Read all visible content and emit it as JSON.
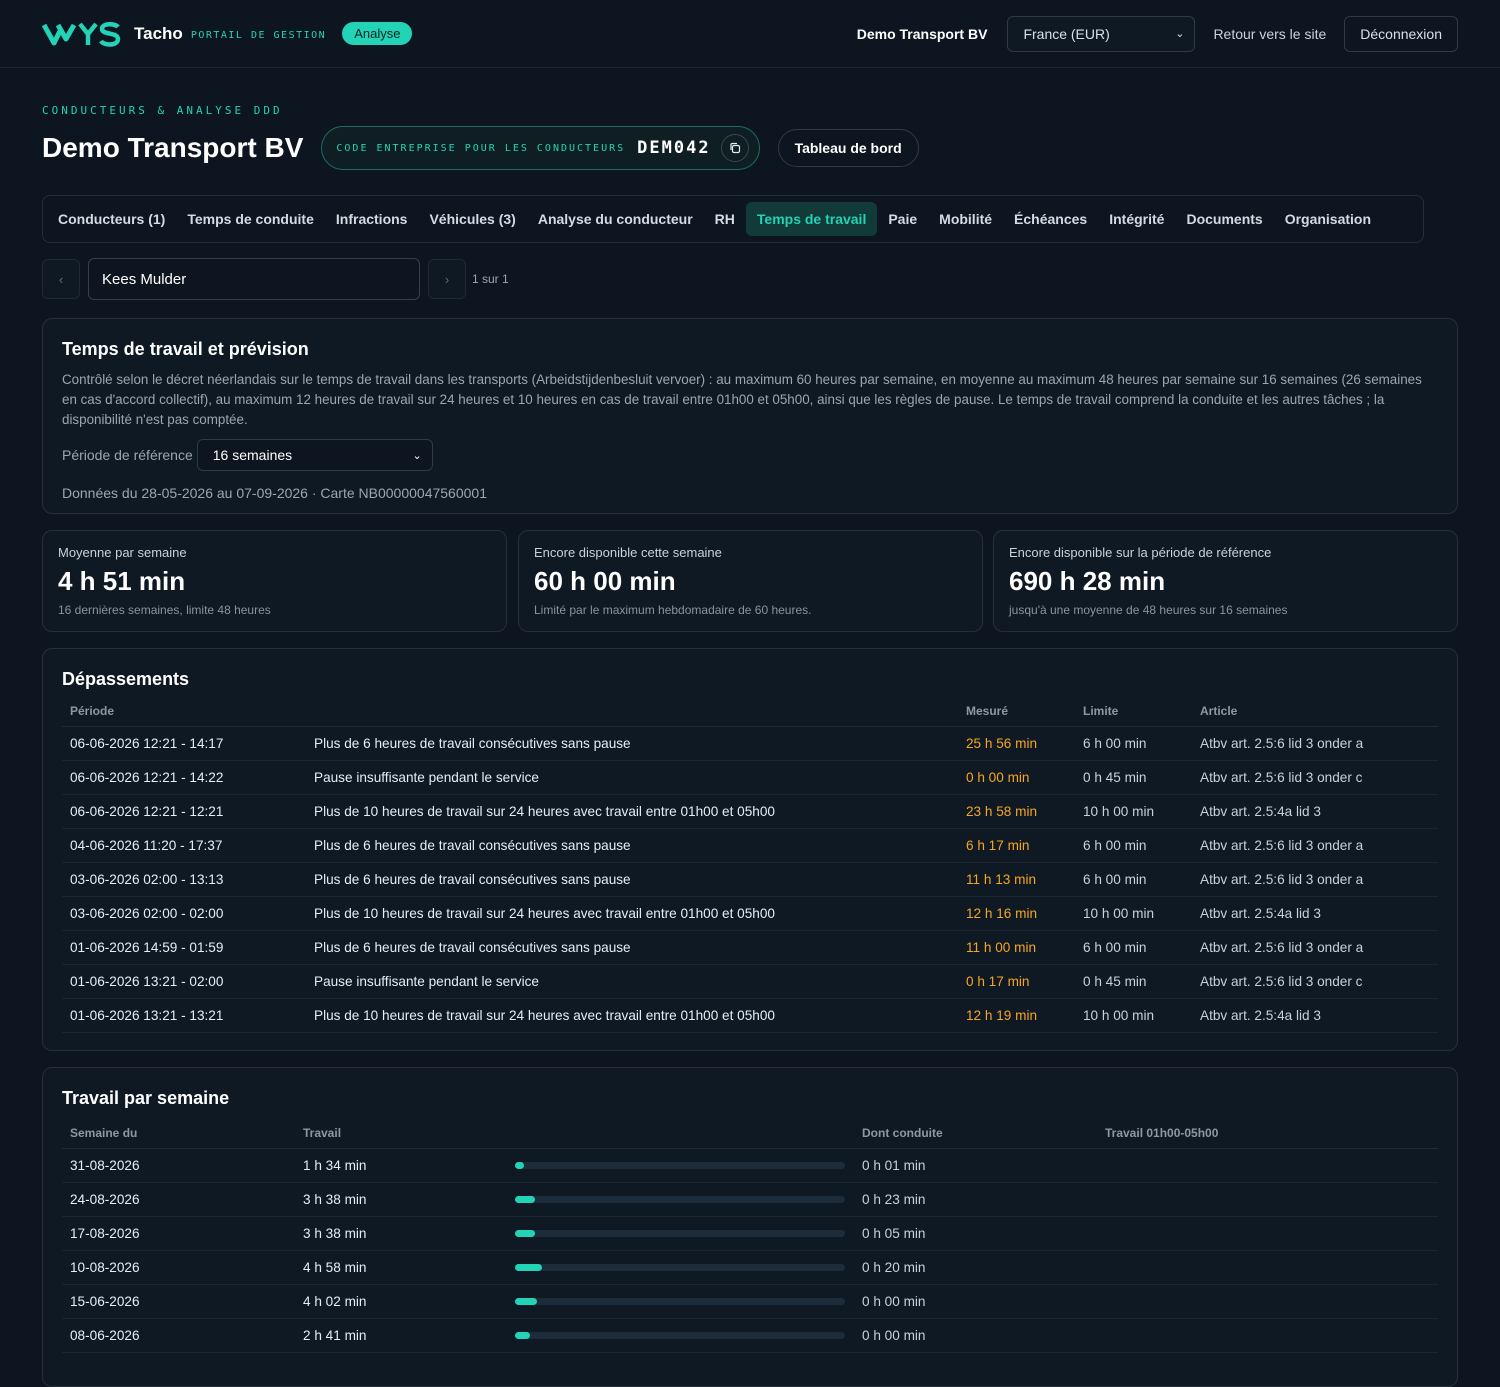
{
  "header": {
    "brand": "Tacho",
    "brand_sub": "PORTAIL DE GESTION",
    "badge": "Analyse",
    "company": "Demo Transport BV",
    "country_select": "France (EUR)",
    "back_link": "Retour vers le site",
    "logout": "Déconnexion",
    "accent_color": "#22d3b6"
  },
  "page": {
    "kicker": "CONDUCTEURS & ANALYSE DDD",
    "title": "Demo Transport BV",
    "code_label": "CODE ENTREPRISE POUR LES CONDUCTEURS",
    "code_value": "DEM042",
    "dashboard_button": "Tableau de bord"
  },
  "tabs": [
    {
      "label": "Conducteurs (1)"
    },
    {
      "label": "Temps de conduite"
    },
    {
      "label": "Infractions"
    },
    {
      "label": "Véhicules (3)"
    },
    {
      "label": "Analyse du conducteur"
    },
    {
      "label": "RH"
    },
    {
      "label": "Temps de travail",
      "active": true
    },
    {
      "label": "Paie"
    },
    {
      "label": "Mobilité"
    },
    {
      "label": "Échéances"
    },
    {
      "label": "Intégrité"
    },
    {
      "label": "Documents"
    },
    {
      "label": "Organisation"
    }
  ],
  "driver": {
    "prev": "‹",
    "next": "›",
    "name": "Kees Mulder",
    "pager": "1 sur 1"
  },
  "intro": {
    "title": "Temps de travail et prévision",
    "description": "Contrôlé selon le décret néerlandais sur le temps de travail dans les transports (Arbeidstijdenbesluit vervoer) : au maximum 60 heures par semaine, en moyenne au maximum 48 heures par semaine sur 16 semaines (26 semaines en cas d'accord collectif), au maximum 12 heures de travail sur 24 heures et 10 heures en cas de travail entre 01h00 et 05h00, ainsi que les règles de pause. Le temps de travail comprend la conduite et les autres tâches ; la disponibilité n'est pas comptée.",
    "ref_label": "Période de référence",
    "ref_value": "16 semaines",
    "data_line": "Données du 28-05-2026 au 07-09-2026 · Carte NB00000047560001"
  },
  "stats": [
    {
      "label": "Moyenne par semaine",
      "value": "4 h 51 min",
      "sub": "16 dernières semaines, limite 48 heures"
    },
    {
      "label": "Encore disponible cette semaine",
      "value": "60 h 00 min",
      "sub": "Limité par le maximum hebdomadaire de 60 heures."
    },
    {
      "label": "Encore disponible sur la période de référence",
      "value": "690 h 28 min",
      "sub": "jusqu'à une moyenne de 48 heures sur 16 semaines"
    }
  ],
  "exceed": {
    "title": "Dépassements",
    "headers": [
      "Période",
      "",
      "Mesuré",
      "Limite",
      "Article"
    ],
    "rows": [
      [
        "06-06-2026 12:21 - 14:17",
        "Plus de 6 heures de travail consécutives sans pause",
        "25 h 56 min",
        "6 h 00 min",
        "Atbv art. 2.5:6 lid 3 onder a"
      ],
      [
        "06-06-2026 12:21 - 14:22",
        "Pause insuffisante pendant le service",
        "0 h 00 min",
        "0 h 45 min",
        "Atbv art. 2.5:6 lid 3 onder c"
      ],
      [
        "06-06-2026 12:21 - 12:21",
        "Plus de 10 heures de travail sur 24 heures avec travail entre 01h00 et 05h00",
        "23 h 58 min",
        "10 h 00 min",
        "Atbv art. 2.5:4a lid 3"
      ],
      [
        "04-06-2026 11:20 - 17:37",
        "Plus de 6 heures de travail consécutives sans pause",
        "6 h 17 min",
        "6 h 00 min",
        "Atbv art. 2.5:6 lid 3 onder a"
      ],
      [
        "03-06-2026 02:00 - 13:13",
        "Plus de 6 heures de travail consécutives sans pause",
        "11 h 13 min",
        "6 h 00 min",
        "Atbv art. 2.5:6 lid 3 onder a"
      ],
      [
        "03-06-2026 02:00 - 02:00",
        "Plus de 10 heures de travail sur 24 heures avec travail entre 01h00 et 05h00",
        "12 h 16 min",
        "10 h 00 min",
        "Atbv art. 2.5:4a lid 3"
      ],
      [
        "01-06-2026 14:59 - 01:59",
        "Plus de 6 heures de travail consécutives sans pause",
        "11 h 00 min",
        "6 h 00 min",
        "Atbv art. 2.5:6 lid 3 onder a"
      ],
      [
        "01-06-2026 13:21 - 02:00",
        "Pause insuffisante pendant le service",
        "0 h 17 min",
        "0 h 45 min",
        "Atbv art. 2.5:6 lid 3 onder c"
      ],
      [
        "01-06-2026 13:21 - 13:21",
        "Plus de 10 heures de travail sur 24 heures avec travail entre 01h00 et 05h00",
        "12 h 19 min",
        "10 h 00 min",
        "Atbv art. 2.5:4a lid 3"
      ]
    ]
  },
  "weekly": {
    "title": "Travail par semaine",
    "headers": [
      "Semaine du",
      "Travail",
      "",
      "Dont conduite",
      "Travail 01h00-05h00"
    ],
    "rows": [
      {
        "week": "31-08-2026",
        "work": "1 h 34 min",
        "fill_percent": 2.6,
        "driving": "0 h 01 min",
        "night": ""
      },
      {
        "week": "24-08-2026",
        "work": "3 h 38 min",
        "fill_percent": 6.1,
        "driving": "0 h 23 min",
        "night": ""
      },
      {
        "week": "17-08-2026",
        "work": "3 h 38 min",
        "fill_percent": 6.1,
        "driving": "0 h 05 min",
        "night": ""
      },
      {
        "week": "10-08-2026",
        "work": "4 h 58 min",
        "fill_percent": 8.3,
        "driving": "0 h 20 min",
        "night": ""
      },
      {
        "week": "15-06-2026",
        "work": "4 h 02 min",
        "fill_percent": 6.7,
        "driving": "0 h 00 min",
        "night": ""
      },
      {
        "week": "08-06-2026",
        "work": "2 h 41 min",
        "fill_percent": 4.5,
        "driving": "0 h 00 min",
        "night": ""
      }
    ]
  }
}
